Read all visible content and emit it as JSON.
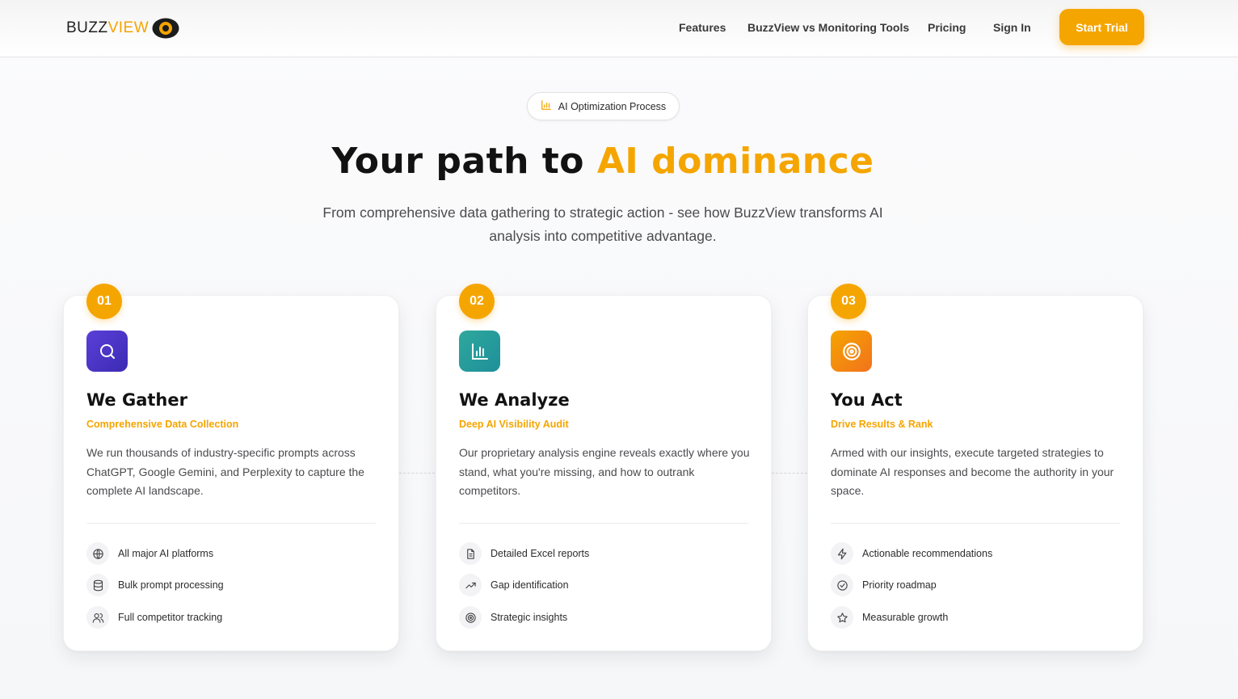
{
  "header": {
    "logo": {
      "part1": "BUZZ",
      "part2": "VIEW"
    },
    "nav": [
      {
        "label": "Features"
      },
      {
        "label": "BuzzView vs Monitoring Tools"
      },
      {
        "label": "Pricing"
      },
      {
        "label": "Sign In"
      }
    ],
    "cta": "Start Trial"
  },
  "hero": {
    "pill": "AI Optimization Process",
    "title_dark": "Your path to",
    "title_accent": "AI dominance",
    "subtitle": "From comprehensive data gathering to strategic action - see how BuzzView transforms AI analysis into competitive advantage."
  },
  "cards": [
    {
      "step": "01",
      "icon": "search-icon",
      "title": "We Gather",
      "subtitle": "Comprehensive Data Collection",
      "description": "We run thousands of industry-specific prompts across ChatGPT, Google Gemini, and Perplexity to capture the complete AI landscape.",
      "features": [
        {
          "icon": "globe-icon",
          "label": "All major AI platforms"
        },
        {
          "icon": "database-icon",
          "label": "Bulk prompt processing"
        },
        {
          "icon": "users-icon",
          "label": "Full competitor tracking"
        }
      ]
    },
    {
      "step": "02",
      "icon": "bar-chart-icon",
      "title": "We Analyze",
      "subtitle": "Deep AI Visibility Audit",
      "description": "Our proprietary analysis engine reveals exactly where you stand, what you're missing, and how to outrank competitors.",
      "features": [
        {
          "icon": "file-text-icon",
          "label": "Detailed Excel reports"
        },
        {
          "icon": "trending-up-icon",
          "label": "Gap identification"
        },
        {
          "icon": "target-icon",
          "label": "Strategic insights"
        }
      ]
    },
    {
      "step": "03",
      "icon": "target-icon",
      "title": "You Act",
      "subtitle": "Drive Results & Rank",
      "description": "Armed with our insights, execute targeted strategies to dominate AI responses and become the authority in your space.",
      "features": [
        {
          "icon": "zap-icon",
          "label": "Actionable recommendations"
        },
        {
          "icon": "check-circle-icon",
          "label": "Priority roadmap"
        },
        {
          "icon": "star-icon",
          "label": "Measurable growth"
        }
      ]
    }
  ],
  "colors": {
    "accent": "#f5a500",
    "gather_gradient": [
      "#5b3fd8",
      "#3b2bb3"
    ],
    "analyze_gradient": [
      "#2fa89d",
      "#1e8f9a"
    ],
    "act_gradient": [
      "#f5a500",
      "#f2721d"
    ]
  }
}
